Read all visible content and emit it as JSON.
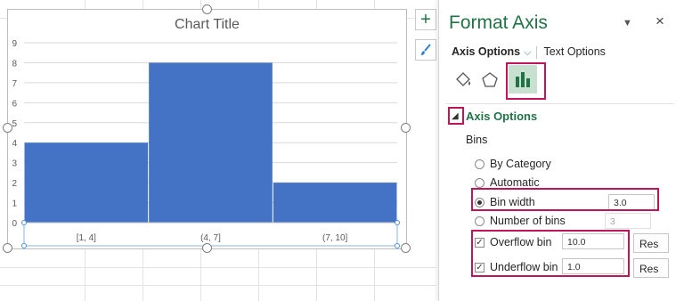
{
  "chart": {
    "title": "Chart Title"
  },
  "chart_data": {
    "type": "bar",
    "categories": [
      "[1, 4]",
      "(4, 7]",
      "(7, 10]"
    ],
    "values": [
      4,
      8,
      2
    ],
    "title": "Chart Title",
    "xlabel": "",
    "ylabel": "",
    "ylim": [
      0,
      9
    ],
    "yticks": [
      "0",
      "1",
      "2",
      "3",
      "4",
      "5",
      "6",
      "7",
      "8",
      "9"
    ],
    "grid": true,
    "bar_color": "#4472c4"
  },
  "side_buttons": [
    {
      "icon": "plus-icon",
      "label": "+"
    },
    {
      "icon": "brush-icon"
    }
  ],
  "pane": {
    "title": "Format Axis",
    "dropdown_icon": "chevron-down-icon",
    "close_label": "×",
    "tabs": {
      "axis_options": "Axis Options",
      "text_options": "Text Options"
    },
    "section_title": "Axis Options",
    "bins_label": "Bins",
    "options": {
      "by_category": "By Category",
      "automatic": "Automatic",
      "bin_width": "Bin width",
      "bin_width_value": "3.0",
      "number_of_bins": "Number of bins",
      "number_of_bins_value": "3",
      "overflow_bin": "Overflow bin",
      "overflow_value": "10.0",
      "underflow_bin": "Underflow bin",
      "underflow_value": "1.0",
      "reset_label": "Res"
    },
    "selected_option": "bin_width",
    "overflow_checked": true,
    "underflow_checked": true,
    "accent_color": "#217346",
    "highlight_color": "#c0145b"
  }
}
